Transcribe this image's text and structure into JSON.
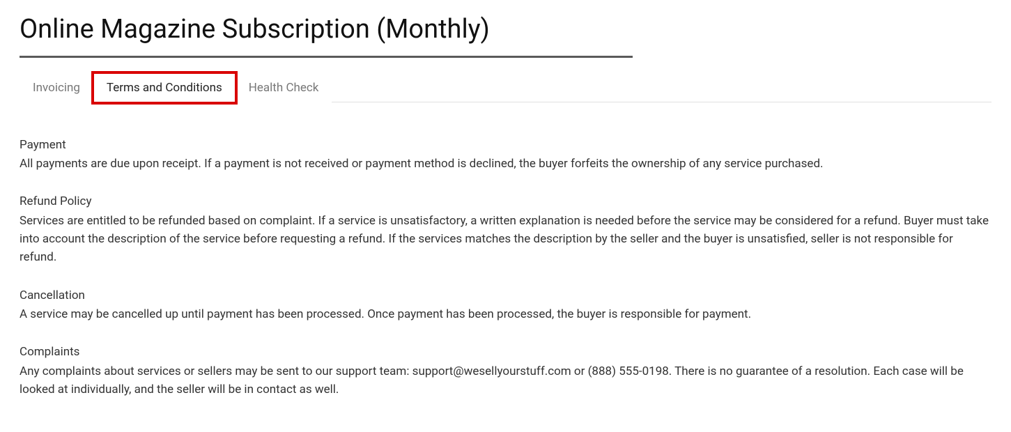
{
  "title": "Online Magazine Subscription (Monthly)",
  "tabs": {
    "invoicing": "Invoicing",
    "terms": "Terms and Conditions",
    "health": "Health Check"
  },
  "sections": {
    "payment": {
      "title": "Payment",
      "body": "All payments are due upon receipt. If a payment is not received or payment method is declined, the buyer forfeits the ownership of any service purchased."
    },
    "refund": {
      "title": "Refund Policy",
      "body": "Services are entitled to be refunded based on complaint. If a service is unsatisfactory, a written explanation is needed before the service may be considered for a refund. Buyer must take into account the description of the service before requesting a refund. If the services matches the description by the seller and the buyer is unsatisfied, seller is not responsible for refund."
    },
    "cancellation": {
      "title": "Cancellation",
      "body": "A service may be cancelled up until payment has been processed. Once payment has been processed, the buyer is responsible for payment."
    },
    "complaints": {
      "title": "Complaints",
      "body": "Any complaints about services or sellers may be sent to our support team: support@wesellyourstuff.com or (888) 555-0198. There is no guarantee of a resolution. Each case will be looked at individually, and the seller will be in contact as well."
    }
  }
}
